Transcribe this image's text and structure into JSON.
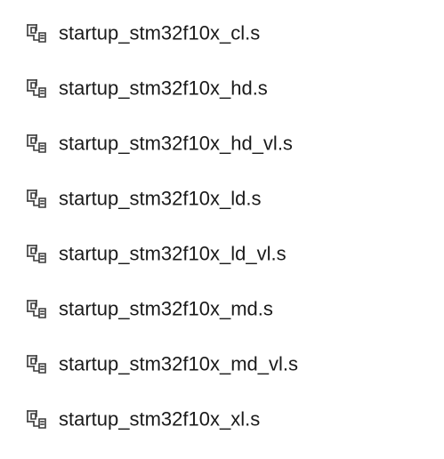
{
  "files": [
    {
      "name": "startup_stm32f10x_cl.s",
      "icon": "assembly-source-file-icon"
    },
    {
      "name": "startup_stm32f10x_hd.s",
      "icon": "assembly-source-file-icon"
    },
    {
      "name": "startup_stm32f10x_hd_vl.s",
      "icon": "assembly-source-file-icon"
    },
    {
      "name": "startup_stm32f10x_ld.s",
      "icon": "assembly-source-file-icon"
    },
    {
      "name": "startup_stm32f10x_ld_vl.s",
      "icon": "assembly-source-file-icon"
    },
    {
      "name": "startup_stm32f10x_md.s",
      "icon": "assembly-source-file-icon"
    },
    {
      "name": "startup_stm32f10x_md_vl.s",
      "icon": "assembly-source-file-icon"
    },
    {
      "name": "startup_stm32f10x_xl.s",
      "icon": "assembly-source-file-icon"
    }
  ],
  "colors": {
    "text": "#1a1a1a",
    "icon": "#3a3a3a",
    "background": "#ffffff"
  }
}
